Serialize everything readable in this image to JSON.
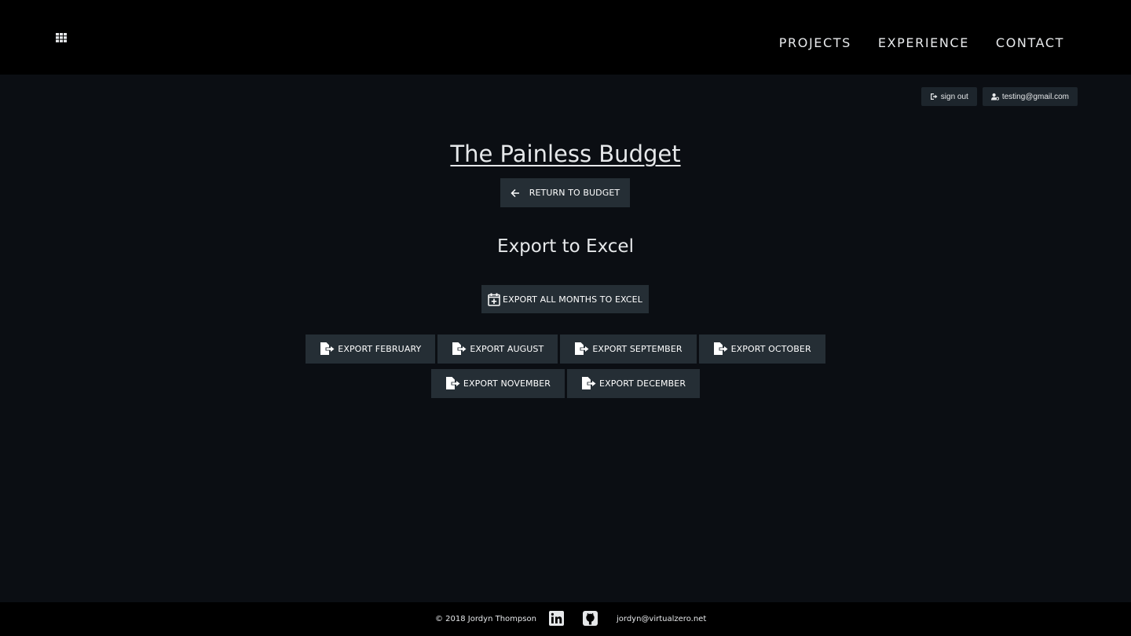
{
  "nav": {
    "items": [
      "PROJECTS",
      "EXPERIENCE",
      "CONTACT"
    ]
  },
  "user_bar": {
    "sign_out": "sign out",
    "email": "testing@gmail.com"
  },
  "main": {
    "title": "The Painless Budget",
    "return_label": "RETURN TO BUDGET",
    "subtitle": "Export to Excel",
    "export_all_label": "EXPORT ALL MONTHS TO EXCEL",
    "months": [
      "EXPORT FEBRUARY",
      "EXPORT AUGUST",
      "EXPORT SEPTEMBER",
      "EXPORT OCTOBER",
      "EXPORT NOVEMBER",
      "EXPORT DECEMBER"
    ]
  },
  "footer": {
    "copyright": "© 2018 Jordyn Thompson",
    "email": "jordyn@virtualzero.net"
  },
  "colors": {
    "page_bg": "#0b0e13",
    "bar_bg": "#000000",
    "button_bg": "#252e35"
  }
}
